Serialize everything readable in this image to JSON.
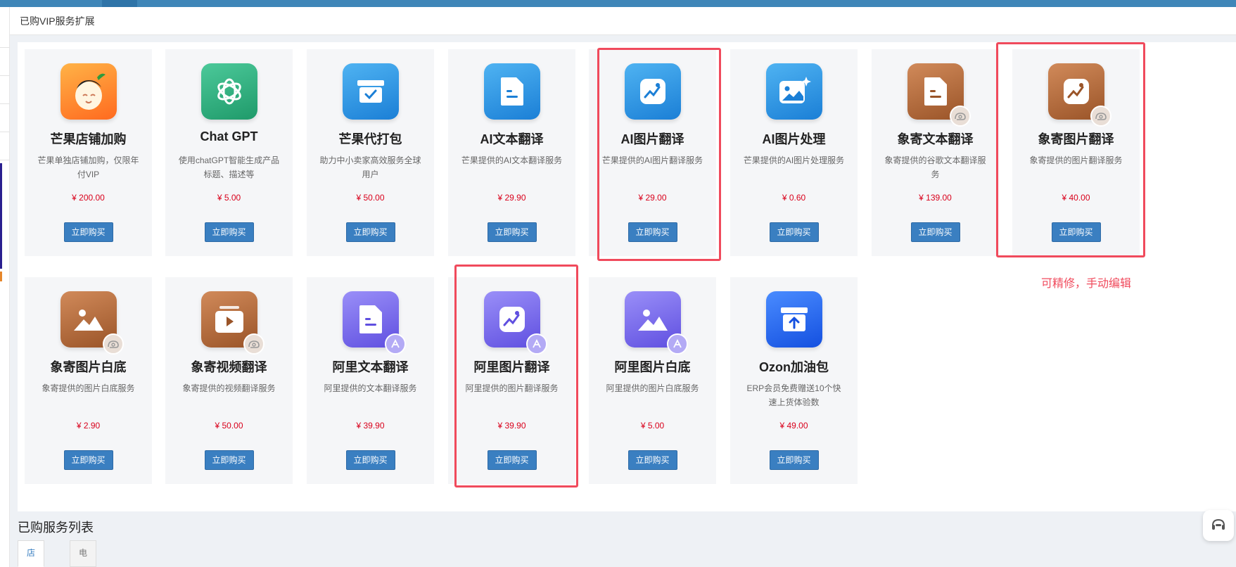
{
  "header": {
    "title": "已购VIP服务扩展"
  },
  "buy_label": "立即购买",
  "cards": [
    {
      "name": "芒果店铺加购",
      "desc": "芒果单独店铺加购，仅限年付VIP",
      "price": "¥ 200.00",
      "icon": "mango-mascot-icon"
    },
    {
      "name": "Chat GPT",
      "desc": "使用chatGPT智能生成产品标题、描述等",
      "price": "¥ 5.00",
      "icon": "chatgpt-icon"
    },
    {
      "name": "芒果代打包",
      "desc": "助力中小卖家高效服务全球用户",
      "price": "¥ 50.00",
      "icon": "package-check-icon"
    },
    {
      "name": "AI文本翻译",
      "desc": "芒果提供的AI文本翻译服务",
      "price": "¥ 29.90",
      "icon": "document-icon"
    },
    {
      "name": "AI图片翻译",
      "desc": "芒果提供的AI图片翻译服务",
      "price": "¥ 29.00",
      "icon": "image-translate-icon"
    },
    {
      "name": "AI图片处理",
      "desc": "芒果提供的AI图片处理服务",
      "price": "¥ 0.60",
      "icon": "image-sparkle-icon"
    },
    {
      "name": "象寄文本翻译",
      "desc": "象寄提供的谷歌文本翻译服务",
      "price": "¥ 139.00",
      "icon": "document-icon"
    },
    {
      "name": "象寄图片翻译",
      "desc": "象寄提供的图片翻译服务",
      "price": "¥ 40.00",
      "icon": "image-translate-icon"
    },
    {
      "name": "象寄图片白底",
      "desc": "象寄提供的图片白底服务",
      "price": "¥ 2.90",
      "icon": "mountain-image-icon"
    },
    {
      "name": "象寄视频翻译",
      "desc": "象寄提供的视频翻译服务",
      "price": "¥ 50.00",
      "icon": "video-play-icon"
    },
    {
      "name": "阿里文本翻译",
      "desc": "阿里提供的文本翻译服务",
      "price": "¥ 39.90",
      "icon": "document-icon"
    },
    {
      "name": "阿里图片翻译",
      "desc": "阿里提供的图片翻译服务",
      "price": "¥ 39.90",
      "icon": "image-translate-icon"
    },
    {
      "name": "阿里图片白底",
      "desc": "阿里提供的图片白底服务",
      "price": "¥ 5.00",
      "icon": "mountain-image-icon"
    },
    {
      "name": "Ozon加油包",
      "desc": "ERP会员免费赠送10个快速上货体验数",
      "price": "¥ 49.00",
      "icon": "upload-box-icon"
    }
  ],
  "annotation": "可精修，手动编辑",
  "section": {
    "title": "已购服务列表"
  },
  "tabs": [
    {
      "label": "店铺扩展",
      "active": true
    },
    {
      "label": "电商内容多语言工具",
      "active": false
    }
  ],
  "colors": {
    "accent": "#3a7fc1",
    "price": "#d9001b",
    "highlight": "#f04a5c",
    "mango_orange": "#ff7a22",
    "chatgpt_green": "#2fae7c",
    "ai_blue": "#2b8fe0",
    "xiangji_brown": "#b8683a",
    "ali_purple": "#7b6ff0",
    "ozon_blue": "#1a63ee"
  }
}
